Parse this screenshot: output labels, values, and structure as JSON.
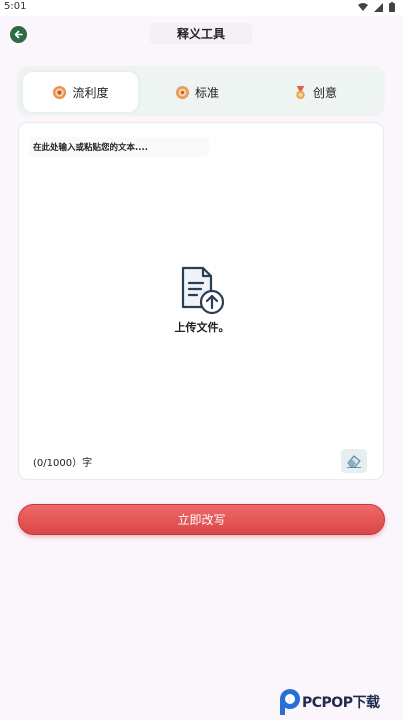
{
  "status_bar": {
    "time": "5:01"
  },
  "header": {
    "title": "释义工具",
    "back_icon": "back-arrow-icon"
  },
  "tabs": [
    {
      "label": "流利度",
      "icon": "fluency-badge-icon",
      "active": true
    },
    {
      "label": "标准",
      "icon": "standard-badge-icon",
      "active": false
    },
    {
      "label": "创意",
      "icon": "creative-medal-icon",
      "active": false
    }
  ],
  "editor": {
    "placeholder": "在此处输入或粘贴您的文本....",
    "upload_label": "上传文件。",
    "counter": "(0/1000）字",
    "upload_icon": "upload-file-icon",
    "clear_icon": "eraser-icon"
  },
  "action": {
    "rewrite_label": "立即改写"
  },
  "watermark": {
    "text": "PCPOP下载"
  },
  "colors": {
    "accent_red": "#e25455",
    "back_green": "#2f6a45",
    "tab_bg": "#eef4f2",
    "page_bg": "#fbf5fc"
  }
}
